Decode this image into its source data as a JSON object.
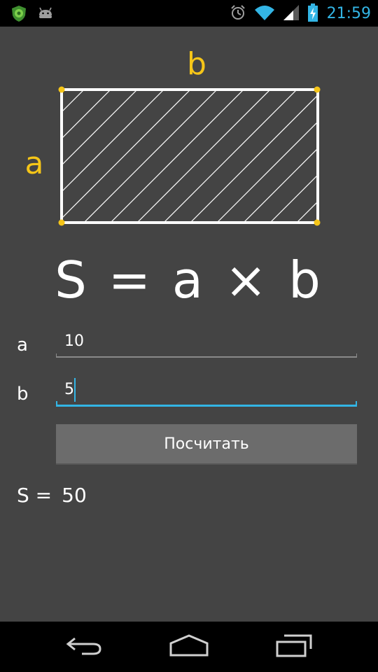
{
  "status_bar": {
    "time": "21:59",
    "icons_left": [
      "shield-notification-icon",
      "android-notification-icon"
    ],
    "icons_right": [
      "alarm-icon",
      "wifi-icon",
      "signal-icon",
      "battery-charging-icon"
    ]
  },
  "diagram": {
    "label_a": "a",
    "label_b": "b"
  },
  "formula": "S = a × b",
  "inputs": {
    "a": {
      "label": "a",
      "value": "10"
    },
    "b": {
      "label": "b",
      "value": "5"
    }
  },
  "button": {
    "label": "Посчитать"
  },
  "result": {
    "prefix": "S =",
    "value": "50"
  },
  "nav": {
    "icons": [
      "back-icon",
      "home-icon",
      "recent-apps-icon"
    ]
  },
  "colors": {
    "background": "#444444",
    "accent": "#33b5e5",
    "diagram_label": "#f5c518",
    "button": "#6c6c6c"
  }
}
